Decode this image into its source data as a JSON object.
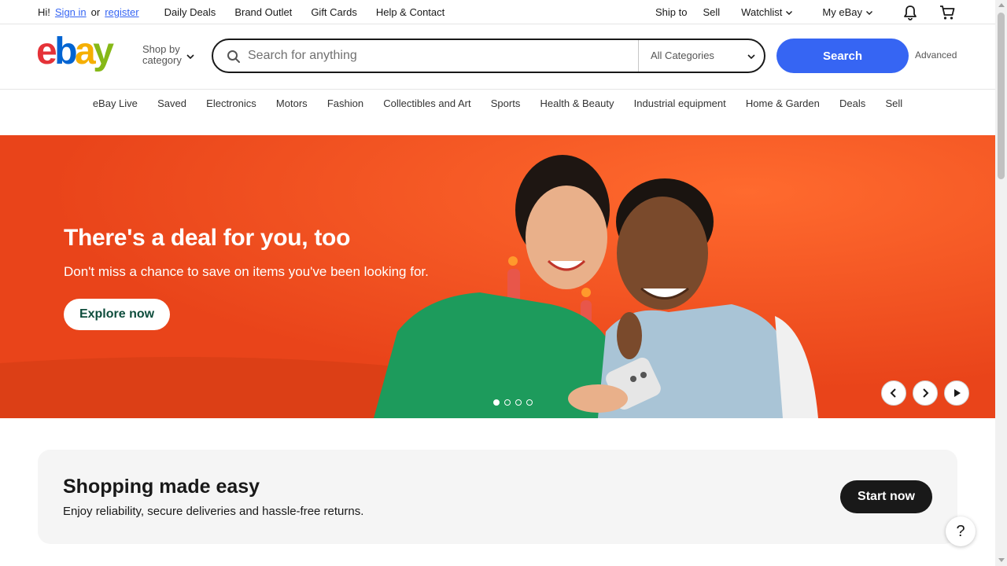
{
  "topbar": {
    "greeting": "Hi!",
    "signin": "Sign in",
    "or": "or",
    "register": "register",
    "links": [
      "Daily Deals",
      "Brand Outlet",
      "Gift Cards",
      "Help & Contact"
    ],
    "ship_to": "Ship to",
    "sell": "Sell",
    "watchlist": "Watchlist",
    "my_ebay": "My eBay",
    "icons": [
      "bell-icon",
      "cart-icon"
    ]
  },
  "header": {
    "logo_text": "ebay",
    "shop_by": "Shop by",
    "category": "category",
    "search_placeholder": "Search for anything",
    "search_value": "",
    "category_select": "All Categories",
    "search_button": "Search",
    "advanced": "Advanced"
  },
  "catnav": [
    "eBay Live",
    "Saved",
    "Electronics",
    "Motors",
    "Fashion",
    "Collectibles and Art",
    "Sports",
    "Health & Beauty",
    "Industrial equipment",
    "Home & Garden",
    "Deals",
    "Sell"
  ],
  "hero": {
    "title": "There's a deal for you, too",
    "subtitle": "Don't miss a chance to save on items you've been looking for.",
    "cta": "Explore now",
    "slide_count": 4,
    "active_slide": 1,
    "background_color": "#f0511d"
  },
  "easy": {
    "title": "Shopping made easy",
    "subtitle": "Enjoy reliability, secure deliveries and hassle-free returns.",
    "cta": "Start now"
  },
  "help": {
    "label": "?"
  },
  "colors": {
    "accent": "#3665f3",
    "hero": "#f0511d",
    "text": "#191919",
    "cta_text": "#0e4d3c"
  }
}
